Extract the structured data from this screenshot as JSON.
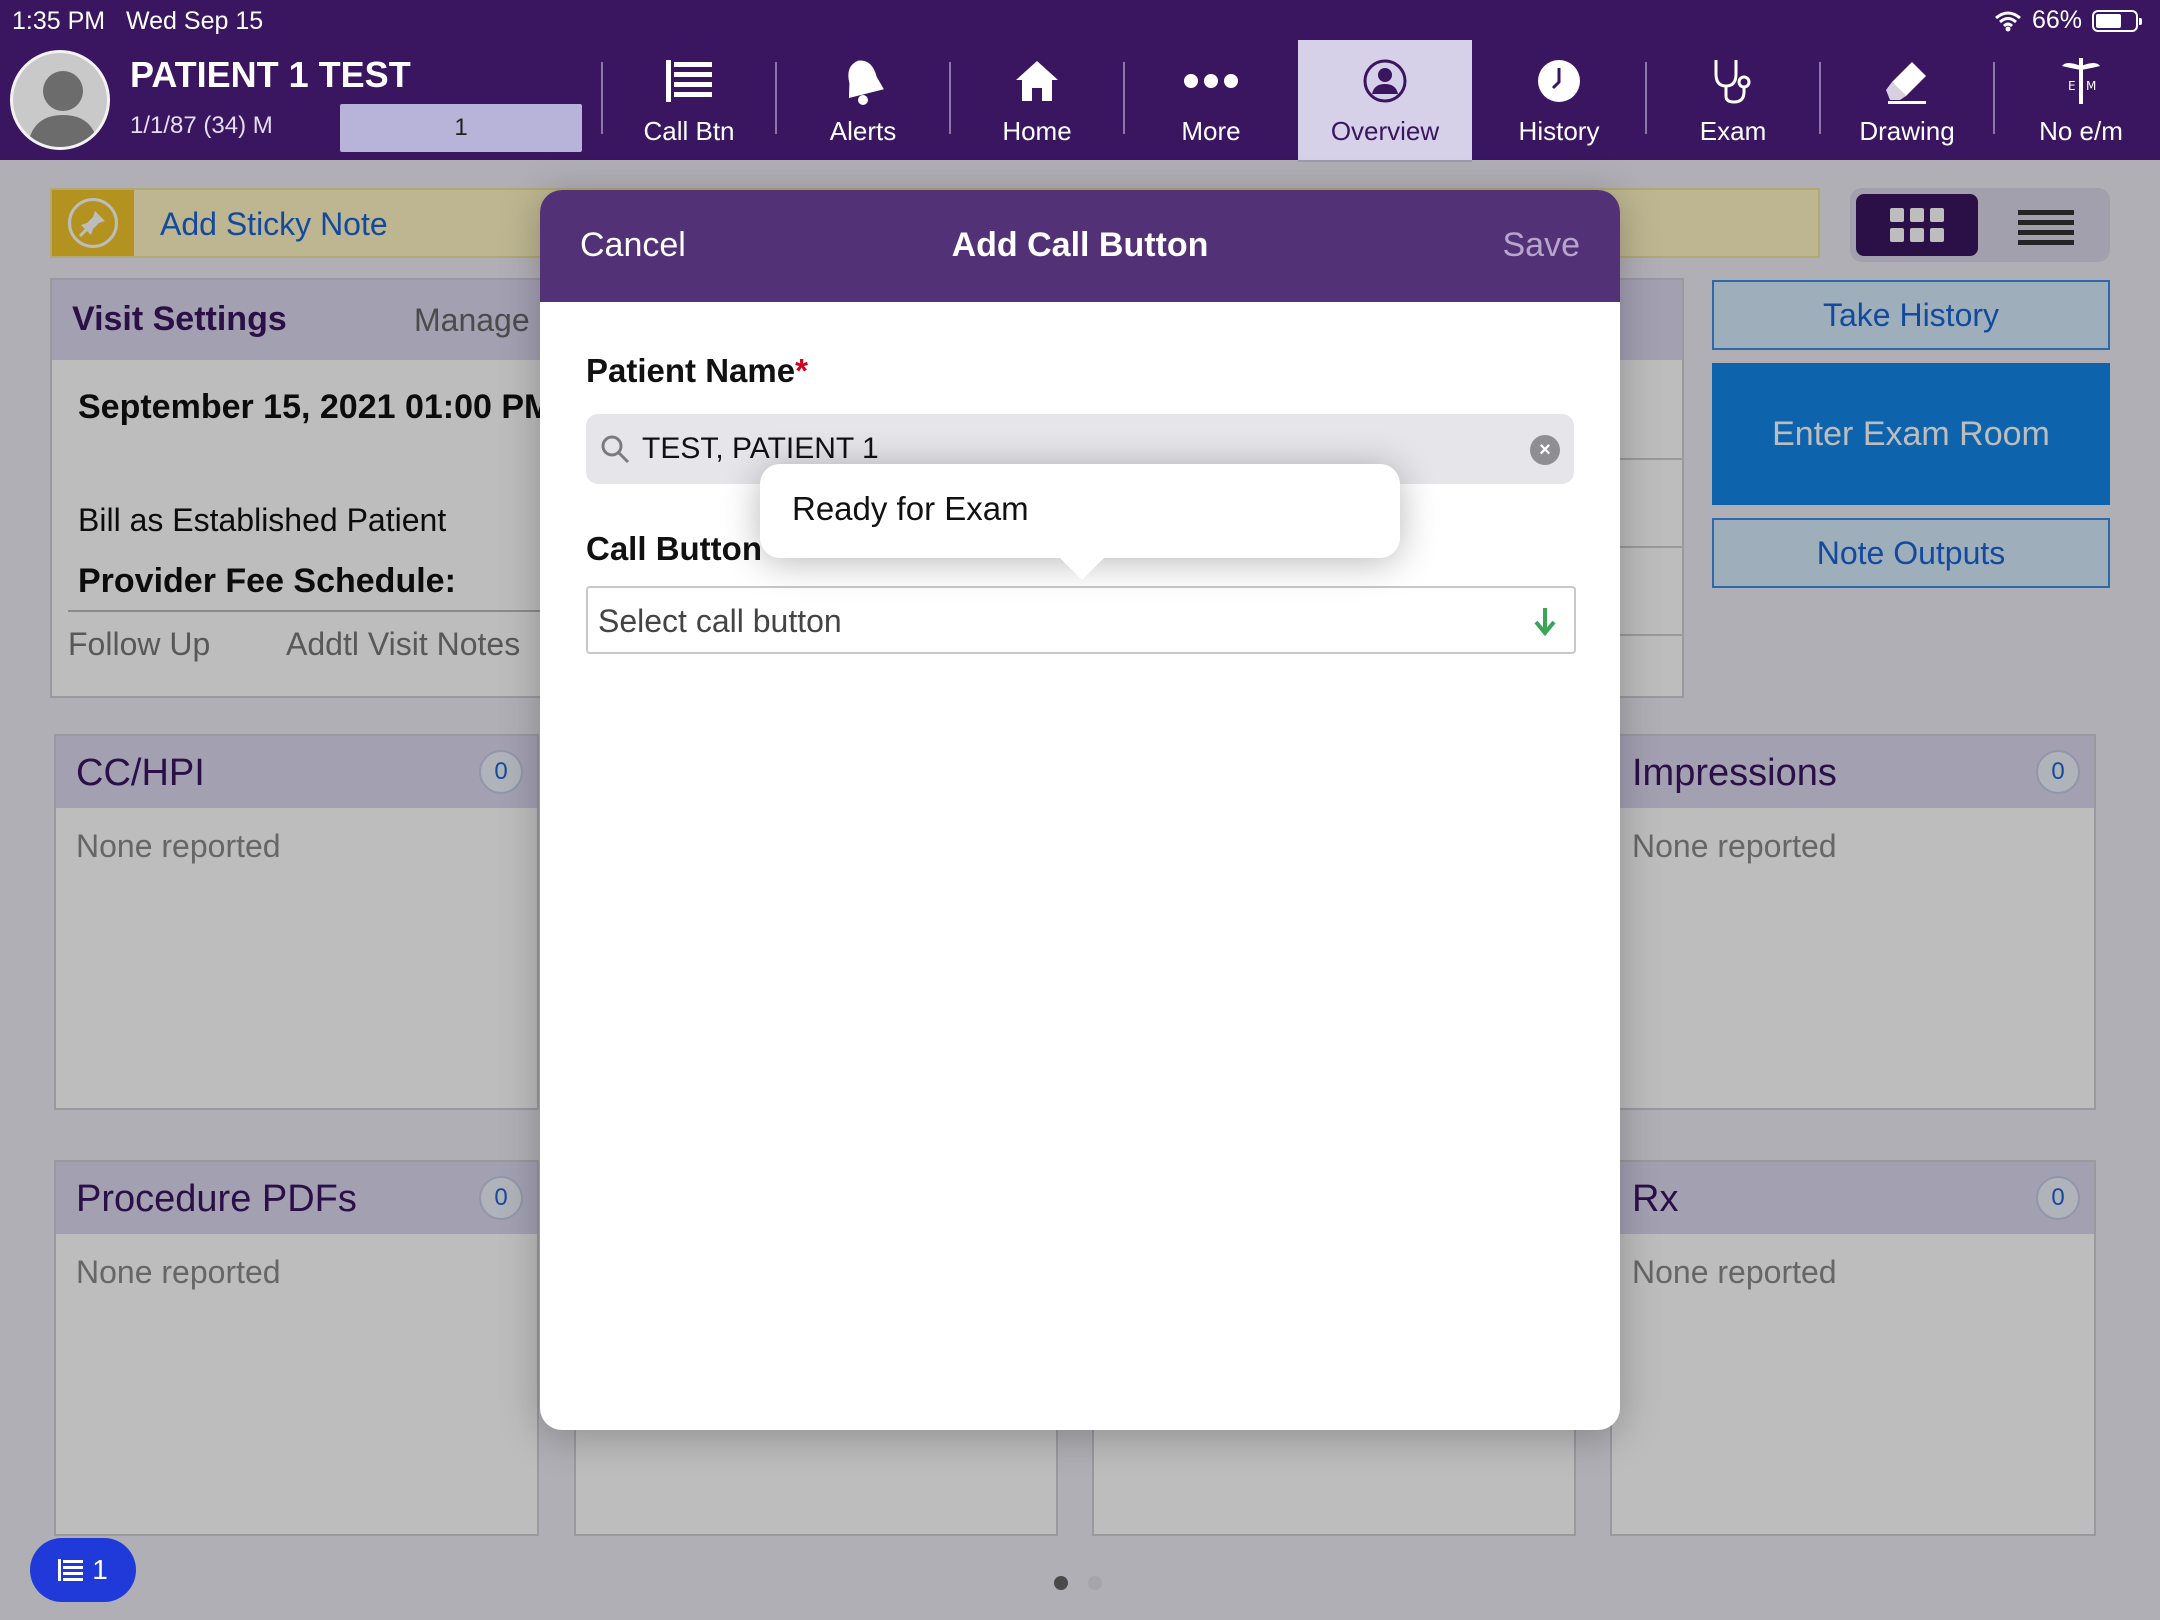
{
  "status_bar": {
    "time": "1:35 PM",
    "date": "Wed Sep 15",
    "battery": "66%"
  },
  "patient": {
    "name": "PATIENT 1 TEST",
    "meta": "1/1/87 (34) M",
    "box_value": "1"
  },
  "nav": [
    {
      "label": "Call Btn",
      "icon": "list-icon",
      "active": false
    },
    {
      "label": "Alerts",
      "icon": "bell-icon",
      "active": false
    },
    {
      "label": "Home",
      "icon": "home-icon",
      "active": false
    },
    {
      "label": "More",
      "icon": "more-icon",
      "active": false
    },
    {
      "label": "Overview",
      "icon": "person-icon",
      "active": true
    },
    {
      "label": "History",
      "icon": "clock-icon",
      "active": false
    },
    {
      "label": "Exam",
      "icon": "stethoscope-icon",
      "active": false
    },
    {
      "label": "Drawing",
      "icon": "eraser-icon",
      "active": false
    },
    {
      "label": "No e/m",
      "icon": "caduceus-icon",
      "active": false
    }
  ],
  "sticky": {
    "label": "Add Sticky Note"
  },
  "visit": {
    "title": "Visit Settings",
    "manage": "Manage",
    "date": "September 15, 2021 01:00 PM",
    "bill": "Bill as Established Patient",
    "fee": "Provider Fee Schedule:",
    "follow_up": "Follow Up",
    "notes": "Addtl Visit Notes"
  },
  "side_buttons": {
    "take_history": "Take History",
    "enter_exam": "Enter Exam Room",
    "note_outputs": "Note Outputs"
  },
  "cards": {
    "cchpi": {
      "title": "CC/HPI",
      "count": "0",
      "body": "None reported"
    },
    "impressions": {
      "title": "Impressions",
      "count": "0",
      "body": "None reported"
    },
    "procedure": {
      "title": "Procedure PDFs",
      "count": "0",
      "body": "None reported"
    },
    "rx": {
      "title": "Rx",
      "count": "0",
      "body": "None reported"
    }
  },
  "floating_badge": {
    "count": "1"
  },
  "modal": {
    "cancel": "Cancel",
    "title": "Add Call Button",
    "save": "Save",
    "patient_label": "Patient Name",
    "required_mark": "*",
    "patient_value": "TEST, PATIENT 1",
    "call_label": "Call Button",
    "call_placeholder": "Select call button"
  },
  "popover": {
    "option": "Ready for Exam"
  },
  "colors": {
    "header": "#3a1560",
    "modal_header": "#533176",
    "accent_blue": "#1488e8",
    "sticky": "#f3c52a"
  }
}
